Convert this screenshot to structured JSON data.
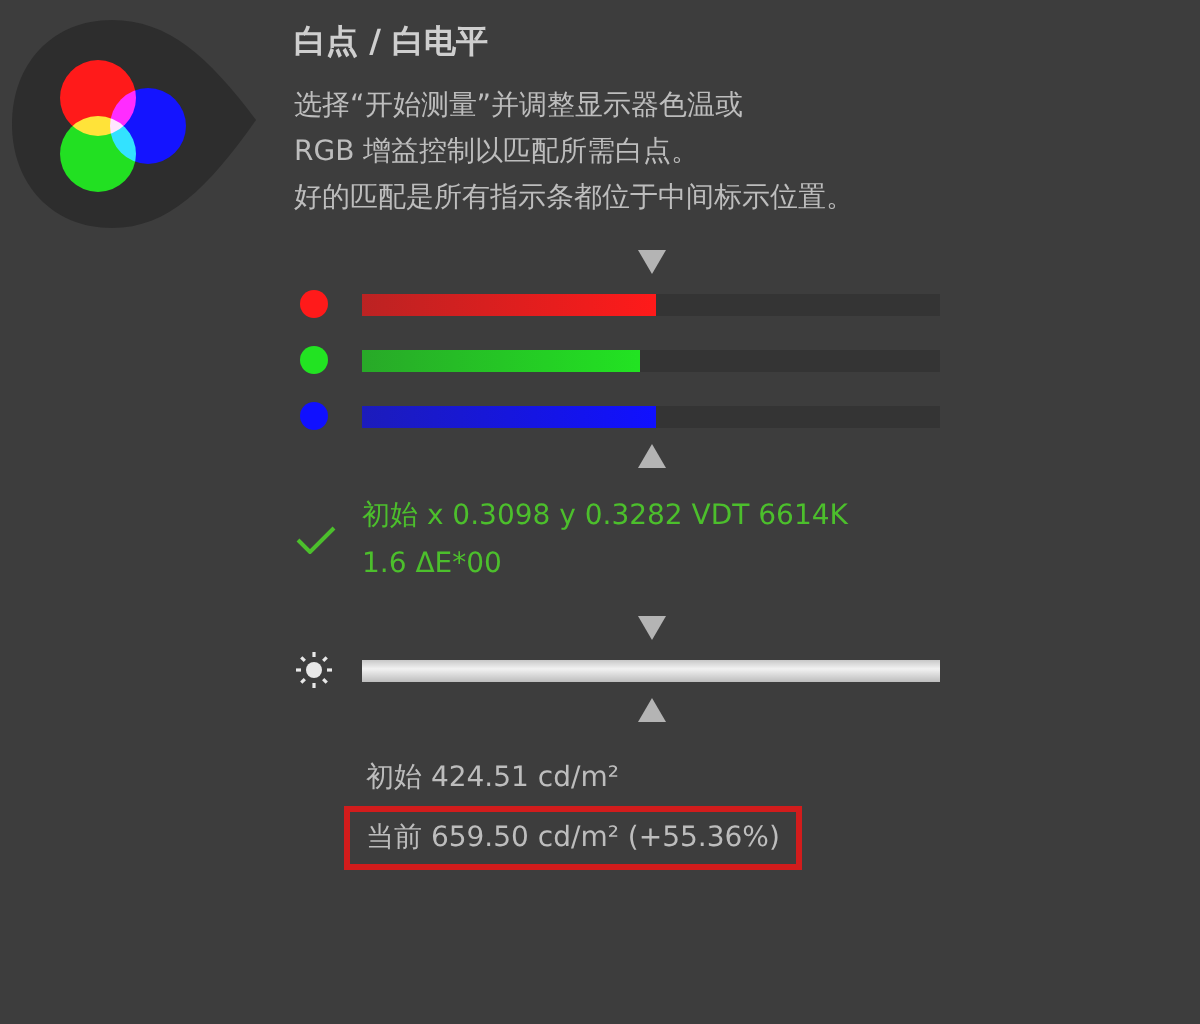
{
  "title": "白点 / 白电平",
  "description": [
    "选择“开始测量”并调整显示器色温或",
    "RGB 增益控制以匹配所需白点。",
    "好的匹配是所有指示条都位于中间标示位置。"
  ],
  "channels": [
    {
      "color": "#ff1a1a",
      "level": 0.51
    },
    {
      "color": "#22e322",
      "level": 0.48
    },
    {
      "color": "#1010ff",
      "level": 0.51
    }
  ],
  "result": {
    "passed": true,
    "lines": [
      "初始 x 0.3098 y 0.3282 VDT 6614K",
      "1.6 ΔE*00"
    ]
  },
  "brightness": {
    "level": 1.0
  },
  "readings": [
    {
      "text": "初始 424.51 cd/m²",
      "highlighted": false
    },
    {
      "text": "当前 659.50 cd/m² (+55.36%)",
      "highlighted": true
    }
  ]
}
